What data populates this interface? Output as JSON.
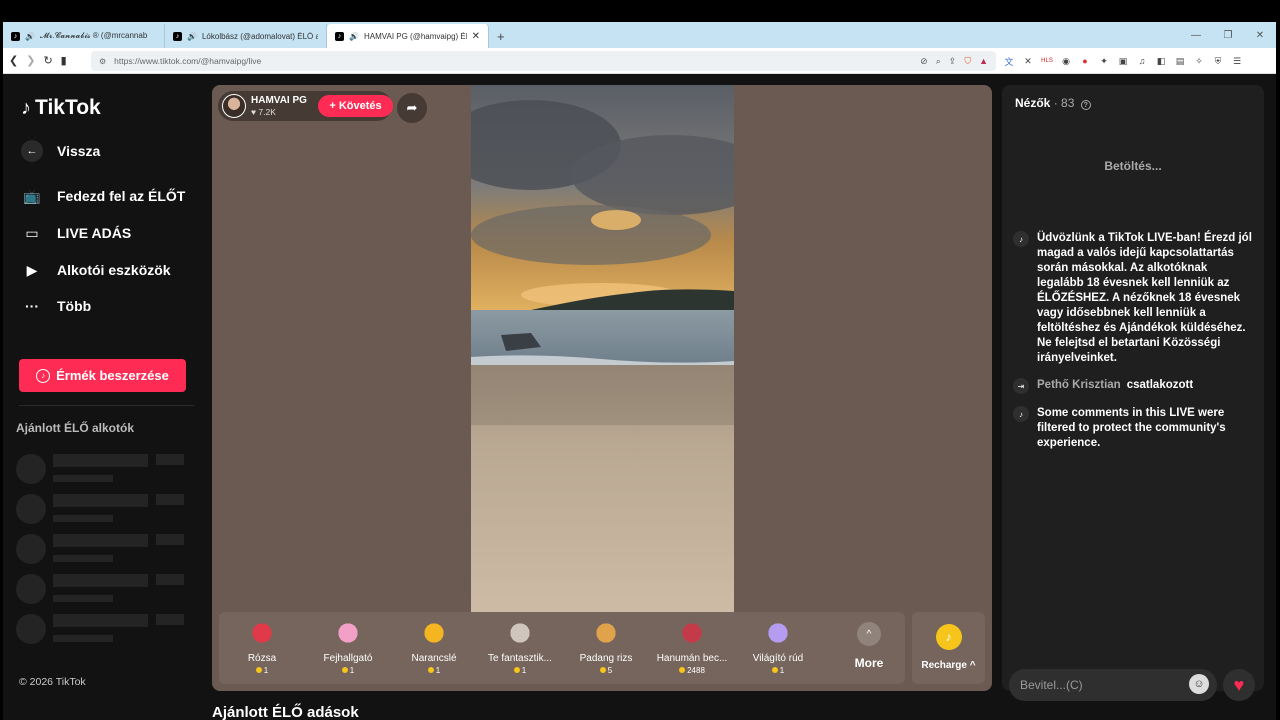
{
  "browser": {
    "tabs": [
      {
        "title": "𝓜𝓻.𝓒𝓪𝓷𝓷𝓪𝓫𝓲𝓼 ® (@mrcannab",
        "active": false
      },
      {
        "title": "Lókolbász (@adomalovat) ÉLŐ a",
        "active": false
      },
      {
        "title": "HAMVAI PG (@hamvaipg) ÉL",
        "active": true
      }
    ],
    "url": "https://www.tiktok.com/@hamvaipg/live",
    "win_min": "—",
    "win_max": "❐",
    "win_close": "✕"
  },
  "sidebar": {
    "logo": "TikTok",
    "items": [
      {
        "label": "Vissza",
        "icon": "back-arrow-icon"
      },
      {
        "label": "Fedezd fel az ÉLŐT",
        "icon": "live-tv-icon"
      },
      {
        "label": "LIVE ADÁS",
        "icon": "camera-icon"
      },
      {
        "label": "Alkotói eszközök",
        "icon": "creator-tools-icon"
      },
      {
        "label": "Több",
        "icon": "more-dots-icon"
      }
    ],
    "coins_button": "Érmék beszerzése",
    "section_title": "Ajánlott ÉLŐ alkotók",
    "copyright": "© 2026 TikTok"
  },
  "stream": {
    "host_name": "HAMVAI PG",
    "host_likes": "7.2K",
    "follow_label": "+ Követés"
  },
  "gifts": [
    {
      "name": "Rózsa",
      "price": "1",
      "color": "#e0394a"
    },
    {
      "name": "Fejhallgató",
      "price": "1",
      "color": "#f2a0c7"
    },
    {
      "name": "Narancslé",
      "price": "1",
      "color": "#f5b421"
    },
    {
      "name": "Te fantasztik...",
      "price": "1",
      "color": "#cfc5bd"
    },
    {
      "name": "Padang rizs",
      "price": "5",
      "color": "#e0a24a"
    },
    {
      "name": "Hanumán bec...",
      "price": "2488",
      "color": "#c43a48"
    },
    {
      "name": "Világító rúd",
      "price": "1",
      "color": "#b69cf0"
    }
  ],
  "gift_more": "More",
  "recharge": "Recharge ^",
  "recommended_title": "Ajánlott ÉLŐ adások",
  "chat": {
    "viewers_label": "Nézők",
    "viewers_count": "· 83",
    "loading": "Betöltés...",
    "welcome": "Üdvözlünk a TikTok LIVE-ban! Érezd jól magad a valós idejű kapcsolattartás során másokkal. Az alkotóknak legalább 18 évesnek kell lenniük az ÉLŐZÉSHEZ. A nézőknek 18 évesnek vagy idősebbnek kell lenniük a feltöltéshez és Ajándékok küldéséhez. Ne felejtsd el betartani Közösségi irányelveinket.",
    "join_user": "Pethő Krisztian",
    "join_text": "csatlakozott",
    "filtered": "Some comments in this LIVE were filtered to protect the community's experience.",
    "input_placeholder": "Bevitel...(C)"
  },
  "colors": {
    "accent": "#fe2c55",
    "stage_bg": "#6b5a51",
    "page_bg": "#121212"
  }
}
